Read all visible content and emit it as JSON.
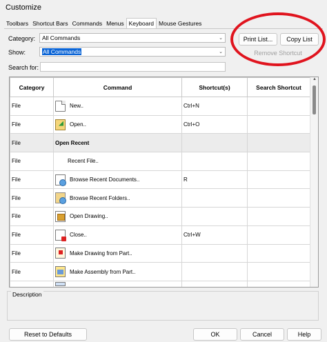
{
  "window": {
    "title": "Customize"
  },
  "tabs": [
    {
      "label": "Toolbars",
      "active": false
    },
    {
      "label": "Shortcut Bars",
      "active": false
    },
    {
      "label": "Commands",
      "active": false
    },
    {
      "label": "Menus",
      "active": false
    },
    {
      "label": "Keyboard",
      "active": true
    },
    {
      "label": "Mouse Gestures",
      "active": false
    }
  ],
  "filters": {
    "category_label": "Category:",
    "category_value": "All Commands",
    "show_label": "Show:",
    "show_value": "All Commands",
    "search_label": "Search for:",
    "search_value": ""
  },
  "actions": {
    "print_list": "Print List...",
    "copy_list": "Copy List",
    "remove_shortcut": "Remove Shortcut"
  },
  "table": {
    "columns": [
      "Category",
      "Command",
      "Shortcut(s)",
      "Search Shortcut"
    ],
    "rows": [
      {
        "category": "File",
        "command": "New..",
        "shortcut": "Ctrl+N",
        "search": "",
        "icon": "new-document-icon",
        "group": false
      },
      {
        "category": "File",
        "command": "Open..",
        "shortcut": "Ctrl+O",
        "search": "",
        "icon": "open-folder-icon",
        "group": false
      },
      {
        "category": "File",
        "command": "Open Recent",
        "shortcut": "",
        "search": "",
        "icon": "",
        "group": true
      },
      {
        "category": "File",
        "command": "Recent File..",
        "shortcut": "",
        "search": "",
        "icon": "",
        "group": false,
        "indent": true
      },
      {
        "category": "File",
        "command": "Browse Recent Documents..",
        "shortcut": "R",
        "search": "",
        "icon": "recent-documents-icon",
        "group": false
      },
      {
        "category": "File",
        "command": "Browse Recent Folders..",
        "shortcut": "",
        "search": "",
        "icon": "recent-folders-icon",
        "group": false
      },
      {
        "category": "File",
        "command": "Open Drawing..",
        "shortcut": "",
        "search": "",
        "icon": "open-drawing-icon",
        "group": false
      },
      {
        "category": "File",
        "command": "Close..",
        "shortcut": "Ctrl+W",
        "search": "",
        "icon": "close-document-icon",
        "group": false
      },
      {
        "category": "File",
        "command": "Make Drawing from Part..",
        "shortcut": "",
        "search": "",
        "icon": "make-drawing-icon",
        "group": false
      },
      {
        "category": "File",
        "command": "Make Assembly from Part..",
        "shortcut": "",
        "search": "",
        "icon": "make-assembly-icon",
        "group": false
      },
      {
        "category": "",
        "command": "",
        "shortcut": "",
        "search": "",
        "icon": "partial-row-icon",
        "group": false
      }
    ]
  },
  "description": {
    "label": "Description"
  },
  "footer": {
    "reset": "Reset to Defaults",
    "ok": "OK",
    "cancel": "Cancel",
    "help": "Help"
  },
  "colors": {
    "annotation": "#e0141e",
    "selection": "#0a64d6"
  }
}
